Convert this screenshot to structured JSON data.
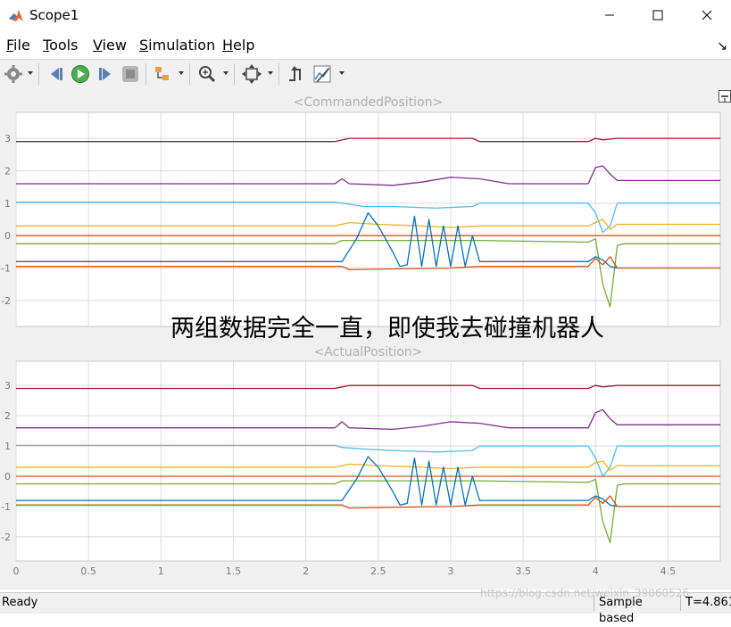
{
  "window": {
    "title": "Scope1"
  },
  "menu": [
    {
      "mnemonic": "F",
      "rest": "ile"
    },
    {
      "mnemonic": "T",
      "rest": "ools"
    },
    {
      "mnemonic": "V",
      "rest": "iew"
    },
    {
      "mnemonic": "S",
      "rest": "imulation"
    },
    {
      "mnemonic": "H",
      "rest": "elp"
    }
  ],
  "toolbar_icons": [
    "gear-icon",
    "step-back-icon",
    "run-icon",
    "step-forward-icon",
    "stop-icon",
    "signal-select-icon",
    "zoom-icon",
    "fit-to-view-icon",
    "triggers-icon",
    "cursor-measurements-icon"
  ],
  "colors": {
    "series": [
      "#a2142f",
      "#7e2f8e",
      "#4dbeee",
      "#edb120",
      "#d95319",
      "#77ac30",
      "#0072bd"
    ],
    "plot_bg": "#ffffff",
    "figure_bg": "#f0f0f0",
    "grid": "#dcdcdc",
    "title_text": "#b0b0b0"
  },
  "annotation": "两组数据完全一直，即使我去碰撞机器人",
  "status": {
    "ready": "Ready",
    "mode": "Sample based",
    "time": "T=4.861"
  },
  "watermark": "https://blog.csdn.net/weixin_39060526",
  "chart_data": [
    {
      "type": "line",
      "title": "<CommandedPosition>",
      "xlim": [
        0,
        4.861
      ],
      "ylim": [
        -2.8,
        3.8
      ],
      "yticks": [
        "3",
        "2",
        "1",
        "0",
        "-1",
        "-2"
      ],
      "xticks": [],
      "grid": true,
      "series": [
        {
          "color": "#a2142f",
          "points": [
            [
              0,
              2.9
            ],
            [
              2.2,
              2.9
            ],
            [
              2.3,
              3.0
            ],
            [
              3.15,
              3.0
            ],
            [
              3.2,
              2.9
            ],
            [
              3.95,
              2.9
            ],
            [
              4.0,
              3.0
            ],
            [
              4.05,
              2.95
            ],
            [
              4.15,
              3.0
            ],
            [
              4.861,
              3.0
            ]
          ]
        },
        {
          "color": "#7e2f8e",
          "points": [
            [
              0,
              1.6
            ],
            [
              2.2,
              1.6
            ],
            [
              2.25,
              1.75
            ],
            [
              2.3,
              1.6
            ],
            [
              2.6,
              1.55
            ],
            [
              2.8,
              1.65
            ],
            [
              3.0,
              1.8
            ],
            [
              3.2,
              1.75
            ],
            [
              3.4,
              1.6
            ],
            [
              3.95,
              1.6
            ],
            [
              4.0,
              2.1
            ],
            [
              4.05,
              2.15
            ],
            [
              4.1,
              1.9
            ],
            [
              4.15,
              1.7
            ],
            [
              4.861,
              1.7
            ]
          ]
        },
        {
          "color": "#4dbeee",
          "points": [
            [
              0,
              1.03
            ],
            [
              2.2,
              1.03
            ],
            [
              2.25,
              1.0
            ],
            [
              2.4,
              0.9
            ],
            [
              2.6,
              0.9
            ],
            [
              2.9,
              0.85
            ],
            [
              3.15,
              0.9
            ],
            [
              3.2,
              1.0
            ],
            [
              3.95,
              1.0
            ],
            [
              4.0,
              0.7
            ],
            [
              4.05,
              0.1
            ],
            [
              4.1,
              0.3
            ],
            [
              4.15,
              1.0
            ],
            [
              4.861,
              1.0
            ]
          ]
        },
        {
          "color": "#edb120",
          "points": [
            [
              0,
              0.3
            ],
            [
              2.2,
              0.3
            ],
            [
              2.3,
              0.4
            ],
            [
              2.5,
              0.35
            ],
            [
              2.8,
              0.3
            ],
            [
              3.0,
              0.25
            ],
            [
              3.2,
              0.3
            ],
            [
              3.95,
              0.3
            ],
            [
              4.0,
              0.4
            ],
            [
              4.05,
              0.5
            ],
            [
              4.1,
              0.2
            ],
            [
              4.15,
              0.35
            ],
            [
              4.861,
              0.35
            ]
          ]
        },
        {
          "color": "#d95319",
          "points": [
            [
              0,
              0.0
            ],
            [
              4.861,
              0.0
            ]
          ]
        },
        {
          "color": "#77ac30",
          "points": [
            [
              0,
              -0.25
            ],
            [
              2.2,
              -0.25
            ],
            [
              2.25,
              -0.15
            ],
            [
              3.2,
              -0.15
            ],
            [
              3.95,
              -0.2
            ],
            [
              4.0,
              -0.1
            ],
            [
              4.05,
              -1.5
            ],
            [
              4.1,
              -2.2
            ],
            [
              4.15,
              -0.3
            ],
            [
              4.2,
              -0.25
            ],
            [
              4.861,
              -0.25
            ]
          ]
        },
        {
          "color": "#0072bd",
          "points": [
            [
              0,
              -0.8
            ],
            [
              2.25,
              -0.8
            ],
            [
              2.35,
              -0.1
            ],
            [
              2.43,
              0.7
            ],
            [
              2.5,
              0.3
            ],
            [
              2.6,
              -0.5
            ],
            [
              2.65,
              -0.95
            ],
            [
              2.7,
              -0.9
            ],
            [
              2.75,
              0.6
            ],
            [
              2.8,
              -0.95
            ],
            [
              2.85,
              0.5
            ],
            [
              2.9,
              -0.95
            ],
            [
              2.95,
              0.3
            ],
            [
              3.0,
              -0.95
            ],
            [
              3.05,
              0.3
            ],
            [
              3.1,
              -0.95
            ],
            [
              3.15,
              0.0
            ],
            [
              3.2,
              -0.8
            ],
            [
              3.95,
              -0.8
            ],
            [
              4.0,
              -0.65
            ],
            [
              4.05,
              -0.75
            ],
            [
              4.1,
              -0.95
            ],
            [
              4.15,
              -1.0
            ],
            [
              4.861,
              -1.0
            ]
          ]
        },
        {
          "color": "#d95319",
          "points": [
            [
              0,
              -0.95
            ],
            [
              2.25,
              -0.95
            ],
            [
              2.3,
              -1.05
            ],
            [
              3.0,
              -1.0
            ],
            [
              3.2,
              -0.95
            ],
            [
              3.95,
              -0.95
            ],
            [
              4.0,
              -0.7
            ],
            [
              4.05,
              -0.9
            ],
            [
              4.1,
              -0.65
            ],
            [
              4.15,
              -1.0
            ],
            [
              4.861,
              -1.0
            ]
          ]
        }
      ]
    },
    {
      "type": "line",
      "title": "<ActualPosition>",
      "xlim": [
        0,
        4.861
      ],
      "ylim": [
        -2.8,
        3.8
      ],
      "yticks": [
        "3",
        "2",
        "1",
        "0",
        "-1",
        "-2"
      ],
      "xticks": [
        "0",
        "0.5",
        "1",
        "1.5",
        "2",
        "2.5",
        "3",
        "3.5",
        "4",
        "4.5"
      ],
      "grid": true,
      "series": [
        {
          "color": "#a2142f",
          "points": [
            [
              0,
              2.9
            ],
            [
              2.2,
              2.9
            ],
            [
              2.3,
              3.0
            ],
            [
              3.15,
              3.0
            ],
            [
              3.2,
              2.9
            ],
            [
              3.95,
              2.9
            ],
            [
              4.0,
              3.0
            ],
            [
              4.05,
              2.95
            ],
            [
              4.15,
              3.0
            ],
            [
              4.861,
              3.0
            ]
          ]
        },
        {
          "color": "#7e2f8e",
          "points": [
            [
              0,
              1.6
            ],
            [
              2.2,
              1.6
            ],
            [
              2.25,
              1.8
            ],
            [
              2.3,
              1.6
            ],
            [
              2.6,
              1.55
            ],
            [
              2.8,
              1.65
            ],
            [
              3.0,
              1.8
            ],
            [
              3.2,
              1.75
            ],
            [
              3.4,
              1.6
            ],
            [
              3.95,
              1.6
            ],
            [
              4.0,
              2.1
            ],
            [
              4.05,
              2.2
            ],
            [
              4.1,
              1.9
            ],
            [
              4.15,
              1.7
            ],
            [
              4.861,
              1.7
            ]
          ]
        },
        {
          "color": "#4dbeee",
          "points": [
            [
              0,
              1.02
            ],
            [
              2.2,
              1.02
            ],
            [
              2.25,
              0.95
            ],
            [
              2.4,
              0.9
            ],
            [
              2.6,
              0.85
            ],
            [
              2.9,
              0.8
            ],
            [
              3.15,
              0.85
            ],
            [
              3.2,
              1.0
            ],
            [
              3.95,
              1.0
            ],
            [
              4.0,
              0.6
            ],
            [
              4.05,
              0.0
            ],
            [
              4.1,
              0.3
            ],
            [
              4.15,
              1.0
            ],
            [
              4.861,
              1.0
            ]
          ]
        },
        {
          "color": "#edb120",
          "points": [
            [
              0,
              0.3
            ],
            [
              2.2,
              0.3
            ],
            [
              2.3,
              0.4
            ],
            [
              2.5,
              0.35
            ],
            [
              2.8,
              0.3
            ],
            [
              3.0,
              0.25
            ],
            [
              3.2,
              0.3
            ],
            [
              3.95,
              0.3
            ],
            [
              4.0,
              0.45
            ],
            [
              4.05,
              0.5
            ],
            [
              4.1,
              0.2
            ],
            [
              4.15,
              0.35
            ],
            [
              4.861,
              0.35
            ]
          ]
        },
        {
          "color": "#d95319",
          "points": [
            [
              0,
              0.0
            ],
            [
              4.861,
              0.0
            ]
          ]
        },
        {
          "color": "#77ac30",
          "points": [
            [
              0,
              -0.25
            ],
            [
              2.2,
              -0.25
            ],
            [
              2.25,
              -0.15
            ],
            [
              3.2,
              -0.15
            ],
            [
              3.95,
              -0.2
            ],
            [
              4.0,
              -0.1
            ],
            [
              4.05,
              -1.5
            ],
            [
              4.1,
              -2.2
            ],
            [
              4.15,
              -0.3
            ],
            [
              4.2,
              -0.25
            ],
            [
              4.861,
              -0.25
            ]
          ]
        },
        {
          "color": "#0072bd",
          "points": [
            [
              0,
              -0.8
            ],
            [
              2.25,
              -0.8
            ],
            [
              2.35,
              -0.1
            ],
            [
              2.43,
              0.65
            ],
            [
              2.5,
              0.3
            ],
            [
              2.6,
              -0.5
            ],
            [
              2.65,
              -0.95
            ],
            [
              2.7,
              -0.9
            ],
            [
              2.75,
              0.6
            ],
            [
              2.8,
              -0.95
            ],
            [
              2.85,
              0.5
            ],
            [
              2.9,
              -0.95
            ],
            [
              2.95,
              0.3
            ],
            [
              3.0,
              -0.95
            ],
            [
              3.05,
              0.3
            ],
            [
              3.1,
              -0.95
            ],
            [
              3.15,
              0.0
            ],
            [
              3.2,
              -0.8
            ],
            [
              3.95,
              -0.8
            ],
            [
              4.0,
              -0.65
            ],
            [
              4.05,
              -0.75
            ],
            [
              4.1,
              -0.95
            ],
            [
              4.15,
              -1.0
            ],
            [
              4.861,
              -1.0
            ]
          ]
        },
        {
          "color": "#d95319",
          "points": [
            [
              0,
              -0.95
            ],
            [
              2.25,
              -0.95
            ],
            [
              2.3,
              -1.05
            ],
            [
              3.0,
              -1.0
            ],
            [
              3.2,
              -0.95
            ],
            [
              3.95,
              -0.95
            ],
            [
              4.0,
              -0.7
            ],
            [
              4.05,
              -0.9
            ],
            [
              4.1,
              -0.65
            ],
            [
              4.15,
              -1.0
            ],
            [
              4.861,
              -1.0
            ]
          ]
        }
      ]
    }
  ]
}
